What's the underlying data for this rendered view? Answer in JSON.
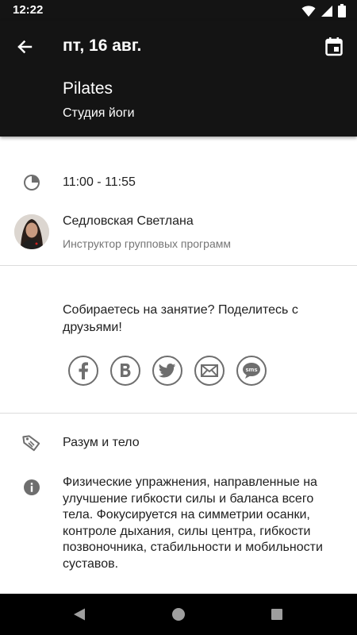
{
  "status_bar": {
    "time": "12:22"
  },
  "header": {
    "date": "пт, 16 авг.",
    "title": "Pilates",
    "studio": "Студия йоги"
  },
  "time_row": {
    "time_range": "11:00 - 11:55"
  },
  "instructor": {
    "name": "Седловская Светлана",
    "role": "Инструктор групповых программ"
  },
  "share": {
    "prompt": "Собираетесь на занятие? Поделитесь с друзьями!",
    "buttons": [
      "facebook-icon",
      "vk-icon",
      "twitter-icon",
      "email-icon",
      "sms-icon"
    ],
    "sms_label": "sms"
  },
  "category": {
    "label": "Разум и тело"
  },
  "description": {
    "text": "Физические упражнения, направленные на улучшение гибкости силы и баланса всего тела. Фокусируется на симметрии осанки, контроле дыхания, силы центра, гибкости позвоночника, стабильности и мобильности суставов."
  },
  "colors": {
    "header_bg": "#141414",
    "icon_gray": "#6e6e6e",
    "text": "#212121",
    "subtext": "#757575"
  }
}
